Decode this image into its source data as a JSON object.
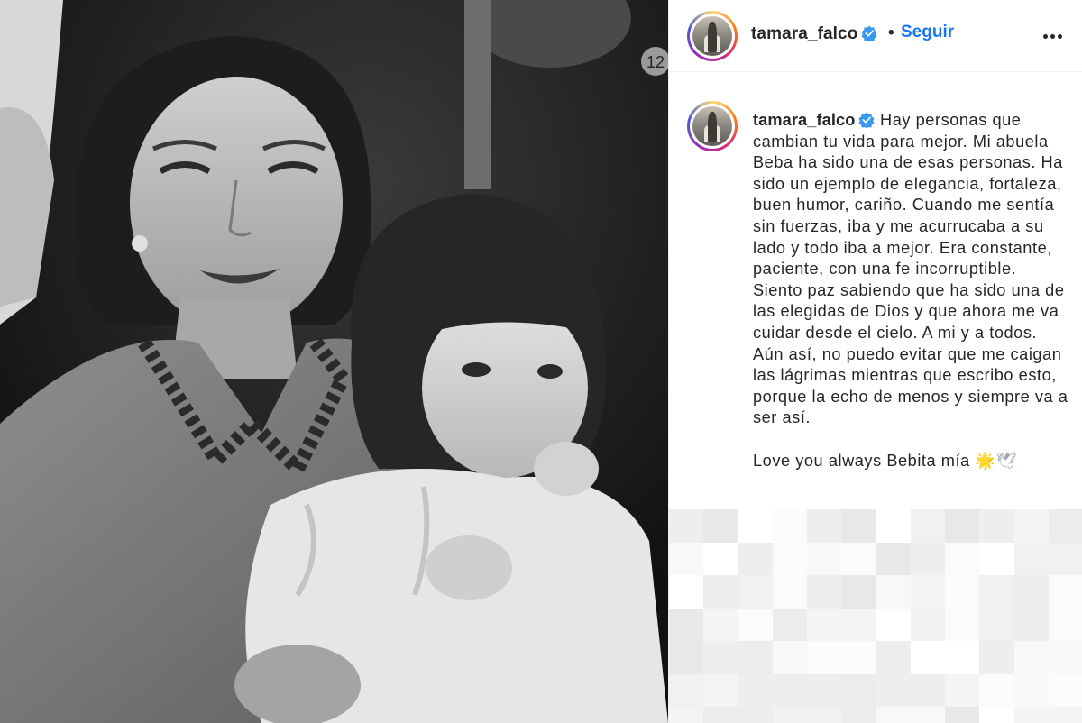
{
  "post": {
    "username": "tamara_falco",
    "separator": "•",
    "follow_label": "Seguir",
    "more_icon": "ellipsis-icon",
    "verified_color": "#3897f0"
  },
  "caption": {
    "username": "tamara_falco",
    "text": "Hay personas que cambian tu vida para mejor. Mi abuela Beba ha sido una de esas personas. Ha sido un ejemplo de elegancia, fortaleza, buen humor, cariño. Cuando me sentía sin fuerzas, iba y me acurrucaba a su lado y todo iba a mejor. Era constante, paciente, con una fe incorruptible. Siento paz sabiendo que ha sido una de las elegidas de Dios y que ahora me va cuidar desde el cielo. A mi y a todos. Aún así, no puedo evitar que me caigan las lágrimas mientras que escribo esto, porque la echo de menos y siempre va a ser así.",
    "signoff": "Love you always Bebita mía",
    "emoji_1": "🌟",
    "emoji_2": "🕊"
  },
  "colors": {
    "link_blue": "#1877f2",
    "text": "#262626",
    "divider": "#efefef"
  }
}
